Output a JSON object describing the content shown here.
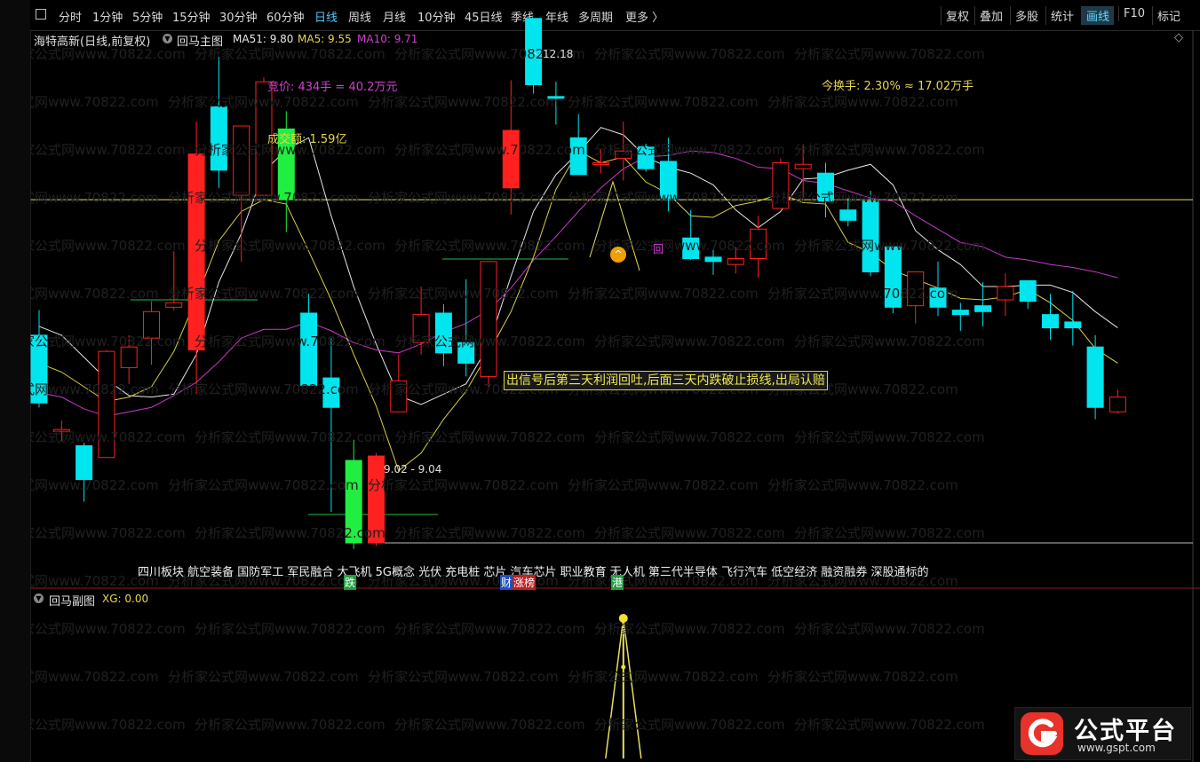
{
  "toolbar": {
    "periods": [
      "分时",
      "1分钟",
      "5分钟",
      "15分钟",
      "30分钟",
      "60分钟",
      "日线",
      "周线",
      "月线",
      "10分钟",
      "45日线",
      "季线",
      "年线",
      "多周期",
      "更多"
    ],
    "active_period": "日线",
    "right_buttons": [
      "复权",
      "叠加",
      "多股",
      "统计",
      "画线",
      "F10",
      "标记"
    ],
    "active_right": "画线"
  },
  "main_panel": {
    "stock_title": "海特高新(日线,前复权)",
    "indicator_name": "回马主图",
    "ma51_label": "MA51: 9.80",
    "ma5_label": "MA5: 9.55",
    "ma10_label": "MA10: 9.71",
    "bid_text": "竞价: 434手 = 40.2万元",
    "turnover_amount": "成交额: 1.59亿",
    "turnover_rate": "今换手: 2.30% ≈ 17.02万手",
    "high_label": "12.18",
    "low_label": "9.02 - 9.04",
    "tip_text": "出信号后第三天利润回吐,后面三天内跌破止损线,出局认赔",
    "sector_tags": "四川板块 航空装备 国防军工 军民融合 大飞机 5G概念 光伏 充电桩 芯片 汽车芯片 职业教育 无人机 第三代半导体 飞行汽车 低空经济 融资融券 深股通标的",
    "marker_labels": [
      "跌",
      "财",
      "涨榜",
      "港"
    ],
    "callout_text": "回"
  },
  "sub_panel": {
    "indicator_name": "回马副图",
    "xg_label": "XG: 0.00"
  },
  "watermark": "分析家公式网www.70822.com",
  "logo": {
    "title": "公式平台",
    "url": "www.gspt.com"
  },
  "icons": {
    "collapse": "chevron-down-circle-icon",
    "diamond": "diamond-icon"
  },
  "colors": {
    "up": "#ff2020",
    "down": "#00e5ee",
    "ma_white": "#e6e6e6",
    "ma_yellow": "#d8d040",
    "ma_purple": "#c838c8",
    "accent": "#52c8ff"
  },
  "chart_data": {
    "type": "candlestick",
    "candles": [
      {
        "o": 10.45,
        "h": 10.62,
        "l": 9.96,
        "c": 9.99
      },
      {
        "o": 9.8,
        "h": 9.87,
        "l": 9.73,
        "c": 9.81
      },
      {
        "o": 9.7,
        "h": 9.72,
        "l": 9.32,
        "c": 9.47
      },
      {
        "o": 9.62,
        "h": 10.35,
        "l": 9.62,
        "c": 10.34
      },
      {
        "o": 10.23,
        "h": 10.45,
        "l": 10.12,
        "c": 10.37
      },
      {
        "o": 10.43,
        "h": 10.68,
        "l": 10.25,
        "c": 10.61
      },
      {
        "o": 10.64,
        "h": 11.02,
        "l": 10.62,
        "c": 10.67
      },
      {
        "o": 10.35,
        "h": 11.9,
        "l": 10.05,
        "c": 11.68
      },
      {
        "o": 12.0,
        "h": 12.34,
        "l": 11.45,
        "c": 11.57
      },
      {
        "o": 11.4,
        "h": 11.85,
        "l": 10.95,
        "c": 11.87
      },
      {
        "o": 11.4,
        "h": 12.2,
        "l": 11.4,
        "c": 12.17
      },
      {
        "o": 11.85,
        "h": 11.97,
        "l": 11.15,
        "c": 11.37
      },
      {
        "o": 10.6,
        "h": 10.73,
        "l": 10.15,
        "c": 10.11
      },
      {
        "o": 10.16,
        "h": 10.43,
        "l": 9.25,
        "c": 9.96
      },
      {
        "o": 9.6,
        "h": 9.74,
        "l": 9.0,
        "c": 9.04
      },
      {
        "o": 9.04,
        "h": 9.65,
        "l": 9.02,
        "c": 9.63
      },
      {
        "o": 9.93,
        "h": 10.32,
        "l": 9.94,
        "c": 10.14
      },
      {
        "o": 10.4,
        "h": 10.78,
        "l": 10.32,
        "c": 10.59
      },
      {
        "o": 10.6,
        "h": 10.66,
        "l": 10.24,
        "c": 10.33
      },
      {
        "o": 10.4,
        "h": 10.83,
        "l": 10.17,
        "c": 10.26
      },
      {
        "o": 10.17,
        "h": 10.8,
        "l": 10.1,
        "c": 10.95
      },
      {
        "o": 11.45,
        "h": 12.18,
        "l": 11.27,
        "c": 11.84
      },
      {
        "o": 12.6,
        "h": 12.18,
        "l": 12.09,
        "c": 12.15
      },
      {
        "o": 12.07,
        "h": 12.17,
        "l": 11.88,
        "c": 12.06
      },
      {
        "o": 11.79,
        "h": 11.95,
        "l": 11.54,
        "c": 11.54
      },
      {
        "o": 11.62,
        "h": 11.71,
        "l": 11.55,
        "c": 11.62
      },
      {
        "o": 11.65,
        "h": 11.9,
        "l": 11.5,
        "c": 11.7
      },
      {
        "o": 11.73,
        "h": 11.75,
        "l": 11.56,
        "c": 11.58
      },
      {
        "o": 11.63,
        "h": 11.79,
        "l": 11.29,
        "c": 11.38
      },
      {
        "o": 11.11,
        "h": 11.3,
        "l": 10.96,
        "c": 10.97
      },
      {
        "o": 10.98,
        "h": 11.03,
        "l": 10.86,
        "c": 10.95
      },
      {
        "o": 10.93,
        "h": 11.05,
        "l": 10.87,
        "c": 10.97
      },
      {
        "o": 10.97,
        "h": 11.26,
        "l": 10.84,
        "c": 11.17
      },
      {
        "o": 11.31,
        "h": 11.65,
        "l": 11.31,
        "c": 11.62
      },
      {
        "o": 11.58,
        "h": 11.75,
        "l": 11.37,
        "c": 11.61
      },
      {
        "o": 11.55,
        "h": 11.62,
        "l": 11.25,
        "c": 11.36
      },
      {
        "o": 11.3,
        "h": 11.38,
        "l": 11.19,
        "c": 11.23
      },
      {
        "o": 11.36,
        "h": 11.43,
        "l": 10.85,
        "c": 10.88
      },
      {
        "o": 11.05,
        "h": 11.05,
        "l": 10.6,
        "c": 10.64
      },
      {
        "o": 10.65,
        "h": 10.87,
        "l": 10.53,
        "c": 10.88
      },
      {
        "o": 10.77,
        "h": 10.95,
        "l": 10.58,
        "c": 10.64
      },
      {
        "o": 10.62,
        "h": 10.67,
        "l": 10.48,
        "c": 10.59
      },
      {
        "o": 10.65,
        "h": 10.81,
        "l": 10.51,
        "c": 10.61
      },
      {
        "o": 10.69,
        "h": 10.87,
        "l": 10.58,
        "c": 10.78
      },
      {
        "o": 10.82,
        "h": 10.81,
        "l": 10.63,
        "c": 10.68
      },
      {
        "o": 10.59,
        "h": 10.73,
        "l": 10.42,
        "c": 10.5
      },
      {
        "o": 10.54,
        "h": 10.75,
        "l": 10.38,
        "c": 10.5
      },
      {
        "o": 10.37,
        "h": 10.45,
        "l": 9.88,
        "c": 9.96
      },
      {
        "o": 9.93,
        "h": 10.08,
        "l": 9.92,
        "c": 10.03
      }
    ],
    "ma_white": [
      10.51,
      10.45,
      10.3,
      10.15,
      10.04,
      10.03,
      10.05,
      10.32,
      10.81,
      11.14,
      11.56,
      11.71,
      11.79,
      11.26,
      10.78,
      10.39,
      10.04,
      9.98,
      10.05,
      10.12,
      10.38,
      10.85,
      11.29,
      11.54,
      11.69,
      11.86,
      11.81,
      11.66,
      11.59,
      11.55,
      11.47,
      11.3,
      11.18,
      11.29,
      11.51,
      11.52,
      11.57,
      11.61,
      11.47,
      11.16,
      11.03,
      10.93,
      10.78,
      10.78,
      10.79,
      10.79,
      10.74,
      10.61,
      10.5
    ],
    "ma_yellow": [
      10.26,
      10.2,
      10.1,
      10.0,
      10.03,
      10.1,
      10.34,
      10.7,
      11.09,
      11.29,
      11.37,
      11.34,
      11.02,
      10.69,
      10.32,
      9.97,
      9.53,
      9.65,
      9.88,
      10.07,
      10.33,
      10.61,
      10.98,
      11.44,
      11.7,
      11.62,
      11.66,
      11.49,
      11.41,
      11.26,
      11.25,
      11.33,
      11.36,
      11.41,
      11.35,
      11.34,
      11.08,
      11.01,
      10.89,
      10.83,
      10.77,
      10.7,
      10.69,
      10.71,
      10.76,
      10.67,
      10.55,
      10.36,
      10.26
    ],
    "ma_purple": [
      10.06,
      10.03,
      9.95,
      9.9,
      9.93,
      9.96,
      10.04,
      10.13,
      10.27,
      10.43,
      10.49,
      10.49,
      10.54,
      10.48,
      10.4,
      10.35,
      10.33,
      10.39,
      10.47,
      10.53,
      10.62,
      10.77,
      10.96,
      11.12,
      11.29,
      11.45,
      11.58,
      11.66,
      11.67,
      11.7,
      11.69,
      11.65,
      11.59,
      11.58,
      11.5,
      11.48,
      11.43,
      11.38,
      11.36,
      11.26,
      11.17,
      11.08,
      11.05,
      10.98,
      10.96,
      10.93,
      10.91,
      10.88,
      10.84
    ],
    "xg": [
      0,
      0,
      0,
      0,
      0,
      0,
      0,
      0,
      0,
      0,
      0,
      0,
      0,
      0,
      0,
      0,
      0,
      0,
      0,
      0,
      0,
      0,
      0,
      0,
      0,
      0,
      1,
      0,
      0,
      0,
      0,
      0,
      0,
      0,
      0,
      0,
      0,
      0,
      0,
      0,
      0,
      0,
      0,
      0,
      0,
      0,
      0,
      0,
      0
    ],
    "support_price": 11.37,
    "stop_price": 9.04,
    "ylim": [
      8.95,
      12.4
    ]
  }
}
